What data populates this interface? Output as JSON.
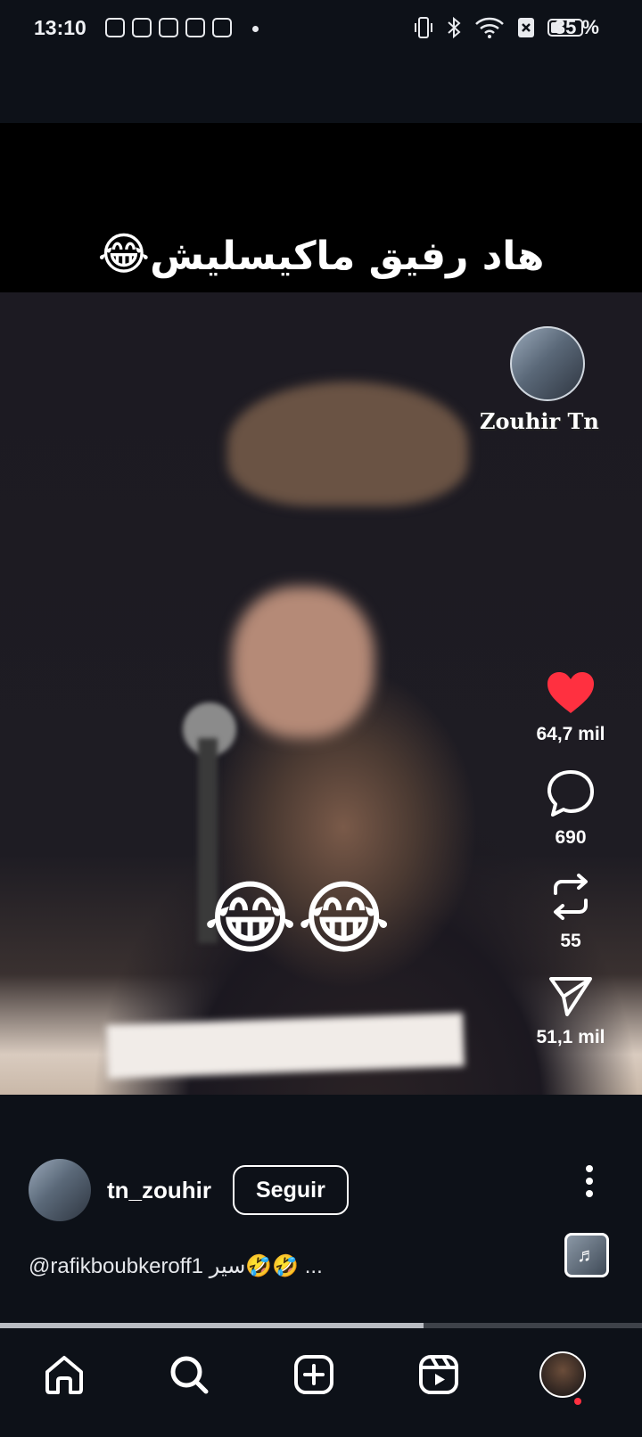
{
  "status_bar": {
    "time": "13:10",
    "battery": "35 %",
    "icons": [
      "discord-icon",
      "discord-icon",
      "play-icon",
      "shazam-icon",
      "hand-icon",
      "vibrate-icon",
      "bluetooth-icon",
      "wifi-icon",
      "x-icon",
      "battery-icon"
    ]
  },
  "post": {
    "video_caption": "هاد رفيق ماكيسليش",
    "video_caption_emoji": "😂",
    "overlay_emoji": "😂😂",
    "watermark_name": "Zouhir Tn",
    "progress": 0.66
  },
  "actions": {
    "likes": "64,7 mil",
    "comments": "690",
    "reposts": "55",
    "shares": "51,1 mil"
  },
  "author": {
    "username": "tn_zouhir",
    "follow_label": "Seguir"
  },
  "caption": {
    "text": "@rafikboubkeroff1 سير🤣🤣 ..."
  },
  "colors": {
    "like": "#ff3040",
    "background": "#0d1118"
  }
}
